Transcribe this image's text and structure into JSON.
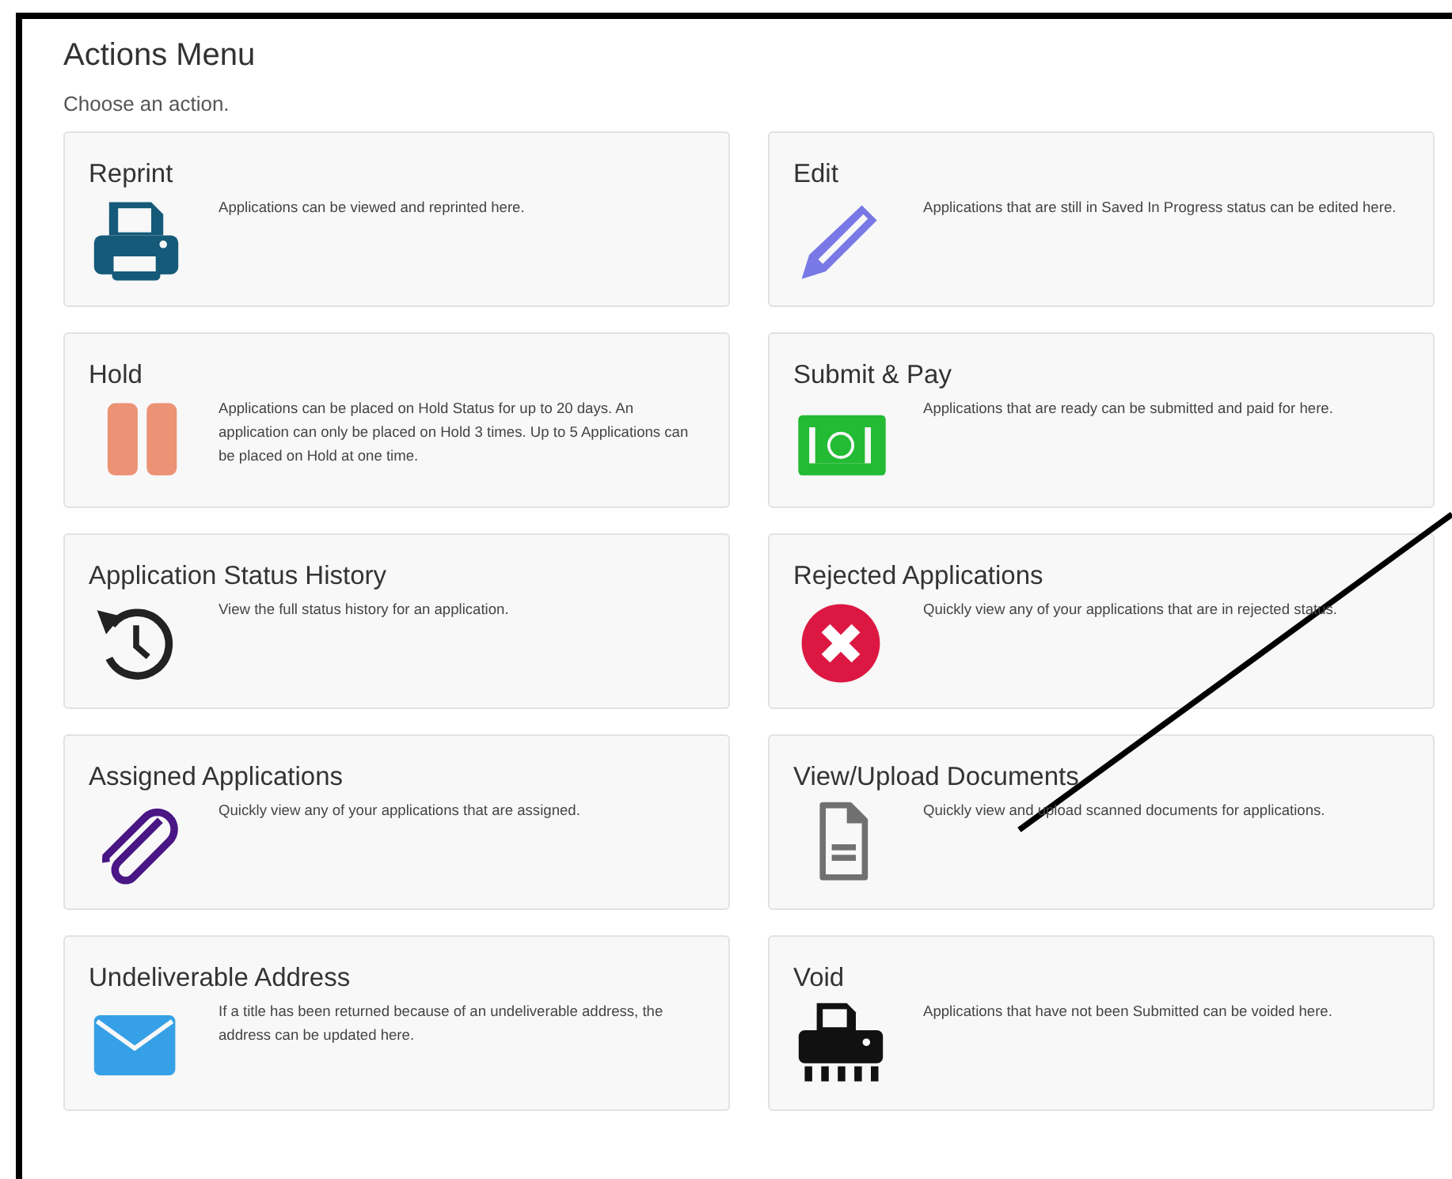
{
  "header": {
    "title": "Actions Menu",
    "subtitle": "Choose an action."
  },
  "actions": [
    {
      "title": "Reprint",
      "description": "Applications can be viewed and reprinted here.",
      "kind": "printer"
    },
    {
      "title": "Edit",
      "description": "Applications that are still in Saved In Progress status can be edited here.",
      "kind": "pencil"
    },
    {
      "title": "Hold",
      "description": "Applications can be placed on Hold Status for up to 20 days. An application can only be placed on Hold 3 times. Up to 5 Applications can be placed on Hold at one time.",
      "kind": "pause"
    },
    {
      "title": "Submit & Pay",
      "description": "Applications that are ready can be submitted and paid for here.",
      "kind": "cash"
    },
    {
      "title": "Application Status History",
      "description": "View the full status history for an application.",
      "kind": "history"
    },
    {
      "title": "Rejected Applications",
      "description": "Quickly view any of your applications that are in rejected status.",
      "kind": "reject"
    },
    {
      "title": "Assigned Applications",
      "description": "Quickly view any of your applications that are assigned.",
      "kind": "paperclip"
    },
    {
      "title": "View/Upload Documents",
      "description": "Quickly view and upload scanned documents for applications.",
      "kind": "document"
    },
    {
      "title": "Undeliverable Address",
      "description": "If a title has been returned because of an undeliverable address, the address can be updated here.",
      "kind": "envelope"
    },
    {
      "title": "Void",
      "description": "Applications that have not been Submitted can be voided here.",
      "kind": "shredder"
    }
  ]
}
